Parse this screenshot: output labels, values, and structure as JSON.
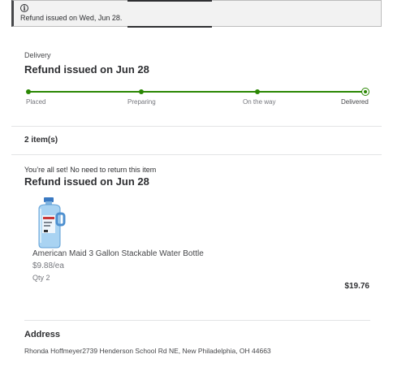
{
  "banner": {
    "icon": "info-icon",
    "text": "Refund issued on Wed, Jun 28."
  },
  "delivery": {
    "label": "Delivery",
    "title": "Refund issued on Jun 28",
    "steps": [
      {
        "label": "Placed",
        "completed": true
      },
      {
        "label": "Preparing",
        "completed": true
      },
      {
        "label": "On the way",
        "completed": true
      },
      {
        "label": "Delivered",
        "completed": true,
        "current": true
      }
    ]
  },
  "items": {
    "count_label": "2 item(s)",
    "return_note": "You’re all set! No need to return this item",
    "title": "Refund issued on Jun 28",
    "product": {
      "image": "water-bottle-image",
      "name": "American Maid 3 Gallon Stackable Water Bottle",
      "unit_price": "$9.88/ea",
      "qty": "Qty 2",
      "total": "$19.76"
    }
  },
  "address": {
    "title": "Address",
    "text": "Rhonda Hoffmeyer2739 Henderson School Rd NE, New Philadelphia, OH 44663"
  },
  "colors": {
    "progress_green": "#2a8703",
    "text_primary": "#2e2f32",
    "banner_bg": "#f2f2f2"
  }
}
